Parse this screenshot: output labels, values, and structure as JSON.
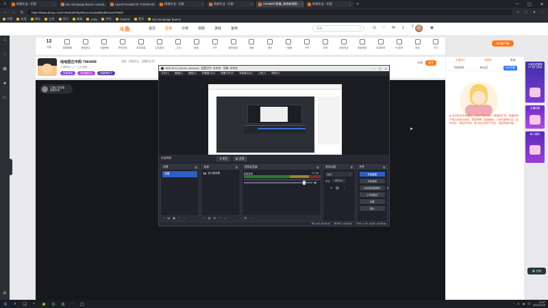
{
  "browser": {
    "tabs": [
      {
        "title": "网络作业 - 乐报",
        "active": false
      },
      {
        "title": "My Homepage Banner cowcat...",
        "active": false
      },
      {
        "title": "Search Results for \"FISHRAIN\"...",
        "active": false
      },
      {
        "title": "网络作业 - 乐报",
        "active": false
      },
      {
        "title": "网络作业 - 乐报",
        "active": false
      },
      {
        "title": "Arena007直播_游戏新视野...",
        "active": true
      },
      {
        "title": "网络作业 - 乐报",
        "active": false
      }
    ],
    "url": "https://www.douyu.com/7464449?dyshid=0-a12648b43621a1079600",
    "bookmarks": [
      "书签",
      "应用",
      "网址",
      "工作",
      "学习",
      "新闻",
      "enitio",
      "中文",
      "TIKNPE",
      "音乐",
      "My Homepage Banner"
    ]
  },
  "site": {
    "logo": "斗鱼",
    "nav": [
      "首页",
      "直播",
      "分类",
      "视频",
      "游戏",
      "鱼吧"
    ],
    "active_nav": "直播",
    "search_placeholder": "搜索",
    "categories": [
      {
        "label": "分类"
      },
      {
        "label": "英雄联盟"
      },
      {
        "label": "绝地求生"
      },
      {
        "label": "王者荣耀"
      },
      {
        "label": "炉石传说"
      },
      {
        "label": "和平精英"
      },
      {
        "label": "主机游戏"
      },
      {
        "label": "二次元"
      },
      {
        "label": "颜值"
      },
      {
        "label": "户外"
      },
      {
        "label": "数码科技"
      },
      {
        "label": "美食"
      },
      {
        "label": "音乐"
      },
      {
        "label": "一起看"
      },
      {
        "label": "汽车"
      },
      {
        "label": "体育"
      },
      {
        "label": "单机热游"
      },
      {
        "label": "网游竞技"
      },
      {
        "label": "手游休闲"
      },
      {
        "label": "PC游戏"
      },
      {
        "label": "综合"
      },
      {
        "label": "学习"
      }
    ],
    "category_count": "12",
    "promo": "PC客户端"
  },
  "room": {
    "name": "动动团正中阳 7464449",
    "tags": "网络 · 网络作业 · 直播间分享",
    "subline": "主播等级 Lv.2 · 正在直播",
    "badges": [
      "当前排名",
      "粉丝团加入",
      "财富榜前十"
    ],
    "follow_label": "关注",
    "share_label": "分享"
  },
  "video": {
    "badge_line1": "主播正在直播",
    "badge_line2": "观看本场"
  },
  "obs": {
    "title": "OBS 30.0.2 (64-bit, windows) - 配置文件: 未命名 - 场景: 未命名",
    "menu": [
      "文件(F)",
      "编辑(E)",
      "视图(V)",
      "停靠窗口(D)",
      "配置文件(P)",
      "场景集合(S)",
      "工具(T)",
      "帮助(H)"
    ],
    "toolbar": {
      "label": "未选择源",
      "props": "属性",
      "filters": "滤镜"
    },
    "docks": {
      "scenes": {
        "title": "场景",
        "items": [
          "场景"
        ]
      },
      "sources": {
        "title": "来源",
        "items": [
          "显示器采集"
        ]
      },
      "mixer": {
        "title": "音频混音器",
        "track": "桌面音频",
        "db": "0.0 dB"
      },
      "transitions": {
        "title": "转场动画",
        "type": "淡出",
        "duration_label": "时长",
        "duration": "300 ms"
      },
      "controls": {
        "title": "控件",
        "buttons": [
          "开始直播",
          "开始录制",
          "启动虚拟摄像机",
          "工作室模式",
          "设置",
          "退出"
        ]
      }
    },
    "status": {
      "live": "LIVE: 00:00:00",
      "rec": "REC: 00:00:00",
      "cpu": "CPU: 0.7%, 30.00 / 30.00 fps"
    }
  },
  "chat": {
    "tabs_top": [
      "主播排行",
      "贡献榜",
      "贵族"
    ],
    "tabs_second": [
      "贡献周榜",
      "粉丝团",
      "VIP开通"
    ],
    "notice": "欢迎来到本直播间，斗鱼严禁未成年人直播或打赏。直播间内严禁出现违法违规、低俗色情、吸烟酗酒、人身伤害等内容，若有违反，请及时举报。请大家注意财产安全，谨防网络诈骗。"
  },
  "side_banners": [
    {
      "text": "斗鱼年终盛典 1/1 热门活动"
    },
    {
      "text": "主播招募"
    },
    {
      "text": "新人福利"
    }
  ],
  "side_widget": "在线",
  "taskbar": {
    "time": "22:07",
    "date": "2022/10/18",
    "lang": "中"
  },
  "colors": {
    "brand": "#ff7a1a",
    "obs_primary": "#2f5fc4",
    "notice": "#e0623a"
  }
}
